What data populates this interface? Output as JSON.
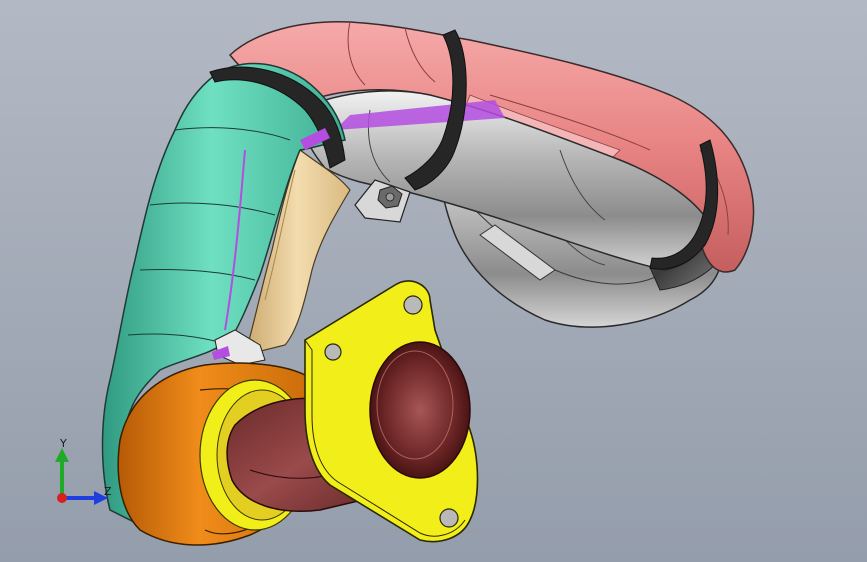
{
  "viewport": {
    "background_top": "#b3b9c4",
    "background_bottom": "#949dab"
  },
  "model": {
    "parts": [
      {
        "name": "hose-section",
        "color": "#5fd3b4"
      },
      {
        "name": "pink-shell",
        "color": "#e98686"
      },
      {
        "name": "silver-housing",
        "color": "#bdbdbd"
      },
      {
        "name": "orange-coupling",
        "color": "#e5800f"
      },
      {
        "name": "yellow-flange",
        "color": "#f2ee1a"
      },
      {
        "name": "brown-pipe",
        "color": "#7a2e2e"
      },
      {
        "name": "clamp-band",
        "color": "#2a2a2a"
      },
      {
        "name": "inner-liner",
        "color": "#e7cfa1"
      },
      {
        "name": "edge-accent",
        "color": "#b44ee0"
      }
    ]
  },
  "triad": {
    "y_label": "Y",
    "z_label": "Z",
    "y_color": "#1faa2a",
    "z_color": "#1f3ee0",
    "origin_color": "#d8201f"
  }
}
